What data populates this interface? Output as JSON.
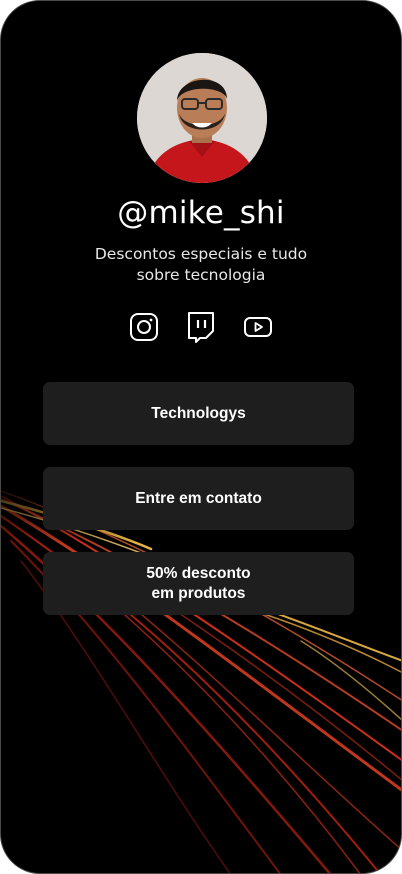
{
  "profile": {
    "handle": "@mike_shi",
    "bio": "Descontos especiais e tudo sobre tecnologia"
  },
  "socials": [
    {
      "icon": "instagram-icon"
    },
    {
      "icon": "twitch-icon"
    },
    {
      "icon": "youtube-icon"
    }
  ],
  "links": [
    {
      "label": "Technologys"
    },
    {
      "label": "Entre em contato"
    },
    {
      "label": "50% desconto\nem produtos"
    }
  ],
  "colors": {
    "background": "#000000",
    "button_bg": "#1e1e1e",
    "text": "#ffffff",
    "trail_red": "#ff3b1f",
    "trail_gold": "#ffc64a"
  }
}
